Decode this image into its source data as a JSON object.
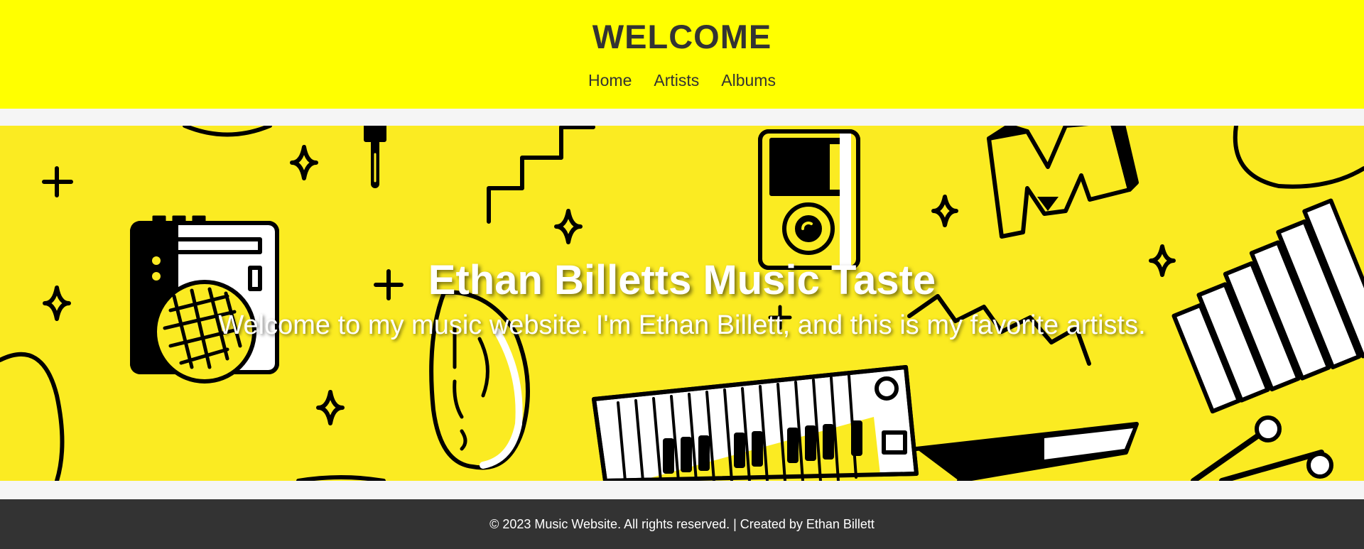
{
  "header": {
    "title": "WELCOME",
    "nav": [
      "Home",
      "Artists",
      "Albums"
    ]
  },
  "hero": {
    "title": "Ethan Billetts Music Taste",
    "subtitle": "Welcome to my music website. I'm Ethan Billett, and this is my favorite artists."
  },
  "footer": {
    "text": "© 2023 Music Website. All rights reserved. | Created by Ethan Billett"
  },
  "colors": {
    "header_bg": "#ffff00",
    "hero_bg": "#fbeb22",
    "footer_bg": "#333333",
    "text_dark": "#333333"
  },
  "icons": [
    "boombox-icon",
    "ear-icon",
    "keytar-icon",
    "xylophone-icon",
    "mp3-player-icon",
    "letter-m-icon",
    "sparkle-icon",
    "plus-icon",
    "aux-plug-icon"
  ]
}
